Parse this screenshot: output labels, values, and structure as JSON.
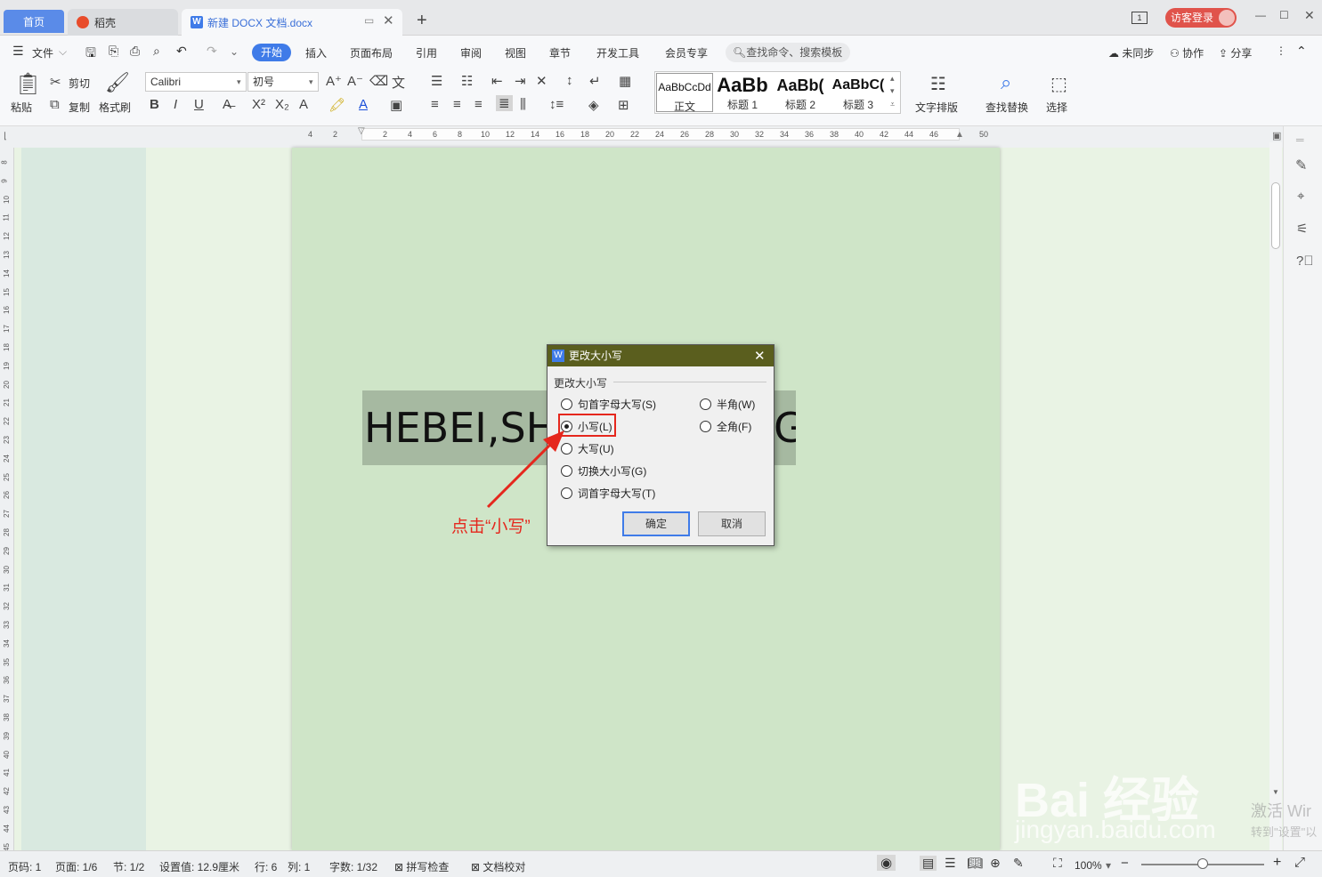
{
  "tabs": {
    "home": "首页",
    "daoke": "稻壳",
    "doc": "新建 DOCX 文档.docx",
    "add": "+"
  },
  "titlebar": {
    "window_count": "1",
    "login": "访客登录"
  },
  "menu": {
    "file": "文件",
    "items": [
      "开始",
      "插入",
      "页面布局",
      "引用",
      "审阅",
      "视图",
      "章节",
      "开发工具",
      "会员专享"
    ],
    "search": "查找命令、搜索模板",
    "right": [
      "未同步",
      "协作",
      "分享"
    ]
  },
  "toolbar": {
    "paste": "粘贴",
    "cut": "剪切",
    "copy": "复制",
    "format_painter": "格式刷",
    "font": "Calibri",
    "size": "初号",
    "bold": "B",
    "italic": "I",
    "underline": "U",
    "styles": [
      {
        "preview": "AaBbCcDd",
        "name": "正文"
      },
      {
        "preview": "AaBb",
        "name": "标题 1"
      },
      {
        "preview": "AaBb(",
        "name": "标题 2"
      },
      {
        "preview": "AaBbC(",
        "name": "标题 3"
      }
    ],
    "text_layout": "文字排版",
    "find_replace": "查找替换",
    "select": "选择"
  },
  "ruler": {
    "marks": [
      "4",
      "2",
      "2",
      "4",
      "6",
      "8",
      "10",
      "12",
      "14",
      "16",
      "18",
      "20",
      "22",
      "24",
      "26",
      "28",
      "30",
      "32",
      "34",
      "36",
      "38",
      "40",
      "42",
      "44",
      "46",
      "50"
    ]
  },
  "vruler": {
    "marks": [
      "8",
      "9",
      "10",
      "11",
      "12",
      "13",
      "14",
      "15",
      "16",
      "17",
      "18",
      "19",
      "20",
      "21",
      "22",
      "23",
      "24",
      "25",
      "26",
      "27",
      "28",
      "29",
      "30",
      "31",
      "32",
      "33",
      "34",
      "35",
      "36",
      "37",
      "38",
      "39",
      "40",
      "41",
      "42",
      "43",
      "44",
      "45"
    ]
  },
  "document": {
    "text": "HEBEI,SH",
    "text_tail": "G"
  },
  "dialog": {
    "title": "更改大小写",
    "group": "更改大小写",
    "options_left": [
      "句首字母大写(S)",
      "小写(L)",
      "大写(U)",
      "切换大小写(G)",
      "词首字母大写(T)"
    ],
    "options_right": [
      "半角(W)",
      "全角(F)"
    ],
    "selected": "小写(L)",
    "ok": "确定",
    "cancel": "取消"
  },
  "annotation": "点击“小写”",
  "status": {
    "page_code": "页码: 1",
    "page": "页面: 1/6",
    "section": "节: 1/2",
    "setting": "设置值: 12.9厘米",
    "row": "行: 6",
    "col": "列: 1",
    "words": "字数: 1/32",
    "spell": "拼写检查",
    "proof": "文档校对",
    "zoom": "100%"
  },
  "watermark": {
    "logo": "Bai 经验",
    "url": "jingyan.baidu.com",
    "activate": "激活 Wir",
    "activate_sub": "转到\"设置\"以"
  },
  "colors": {
    "accent": "#3f7be8",
    "dialog_title": "#5a5e1e",
    "highlight": "#e5271d",
    "page_bg": "#cfe5c8"
  }
}
